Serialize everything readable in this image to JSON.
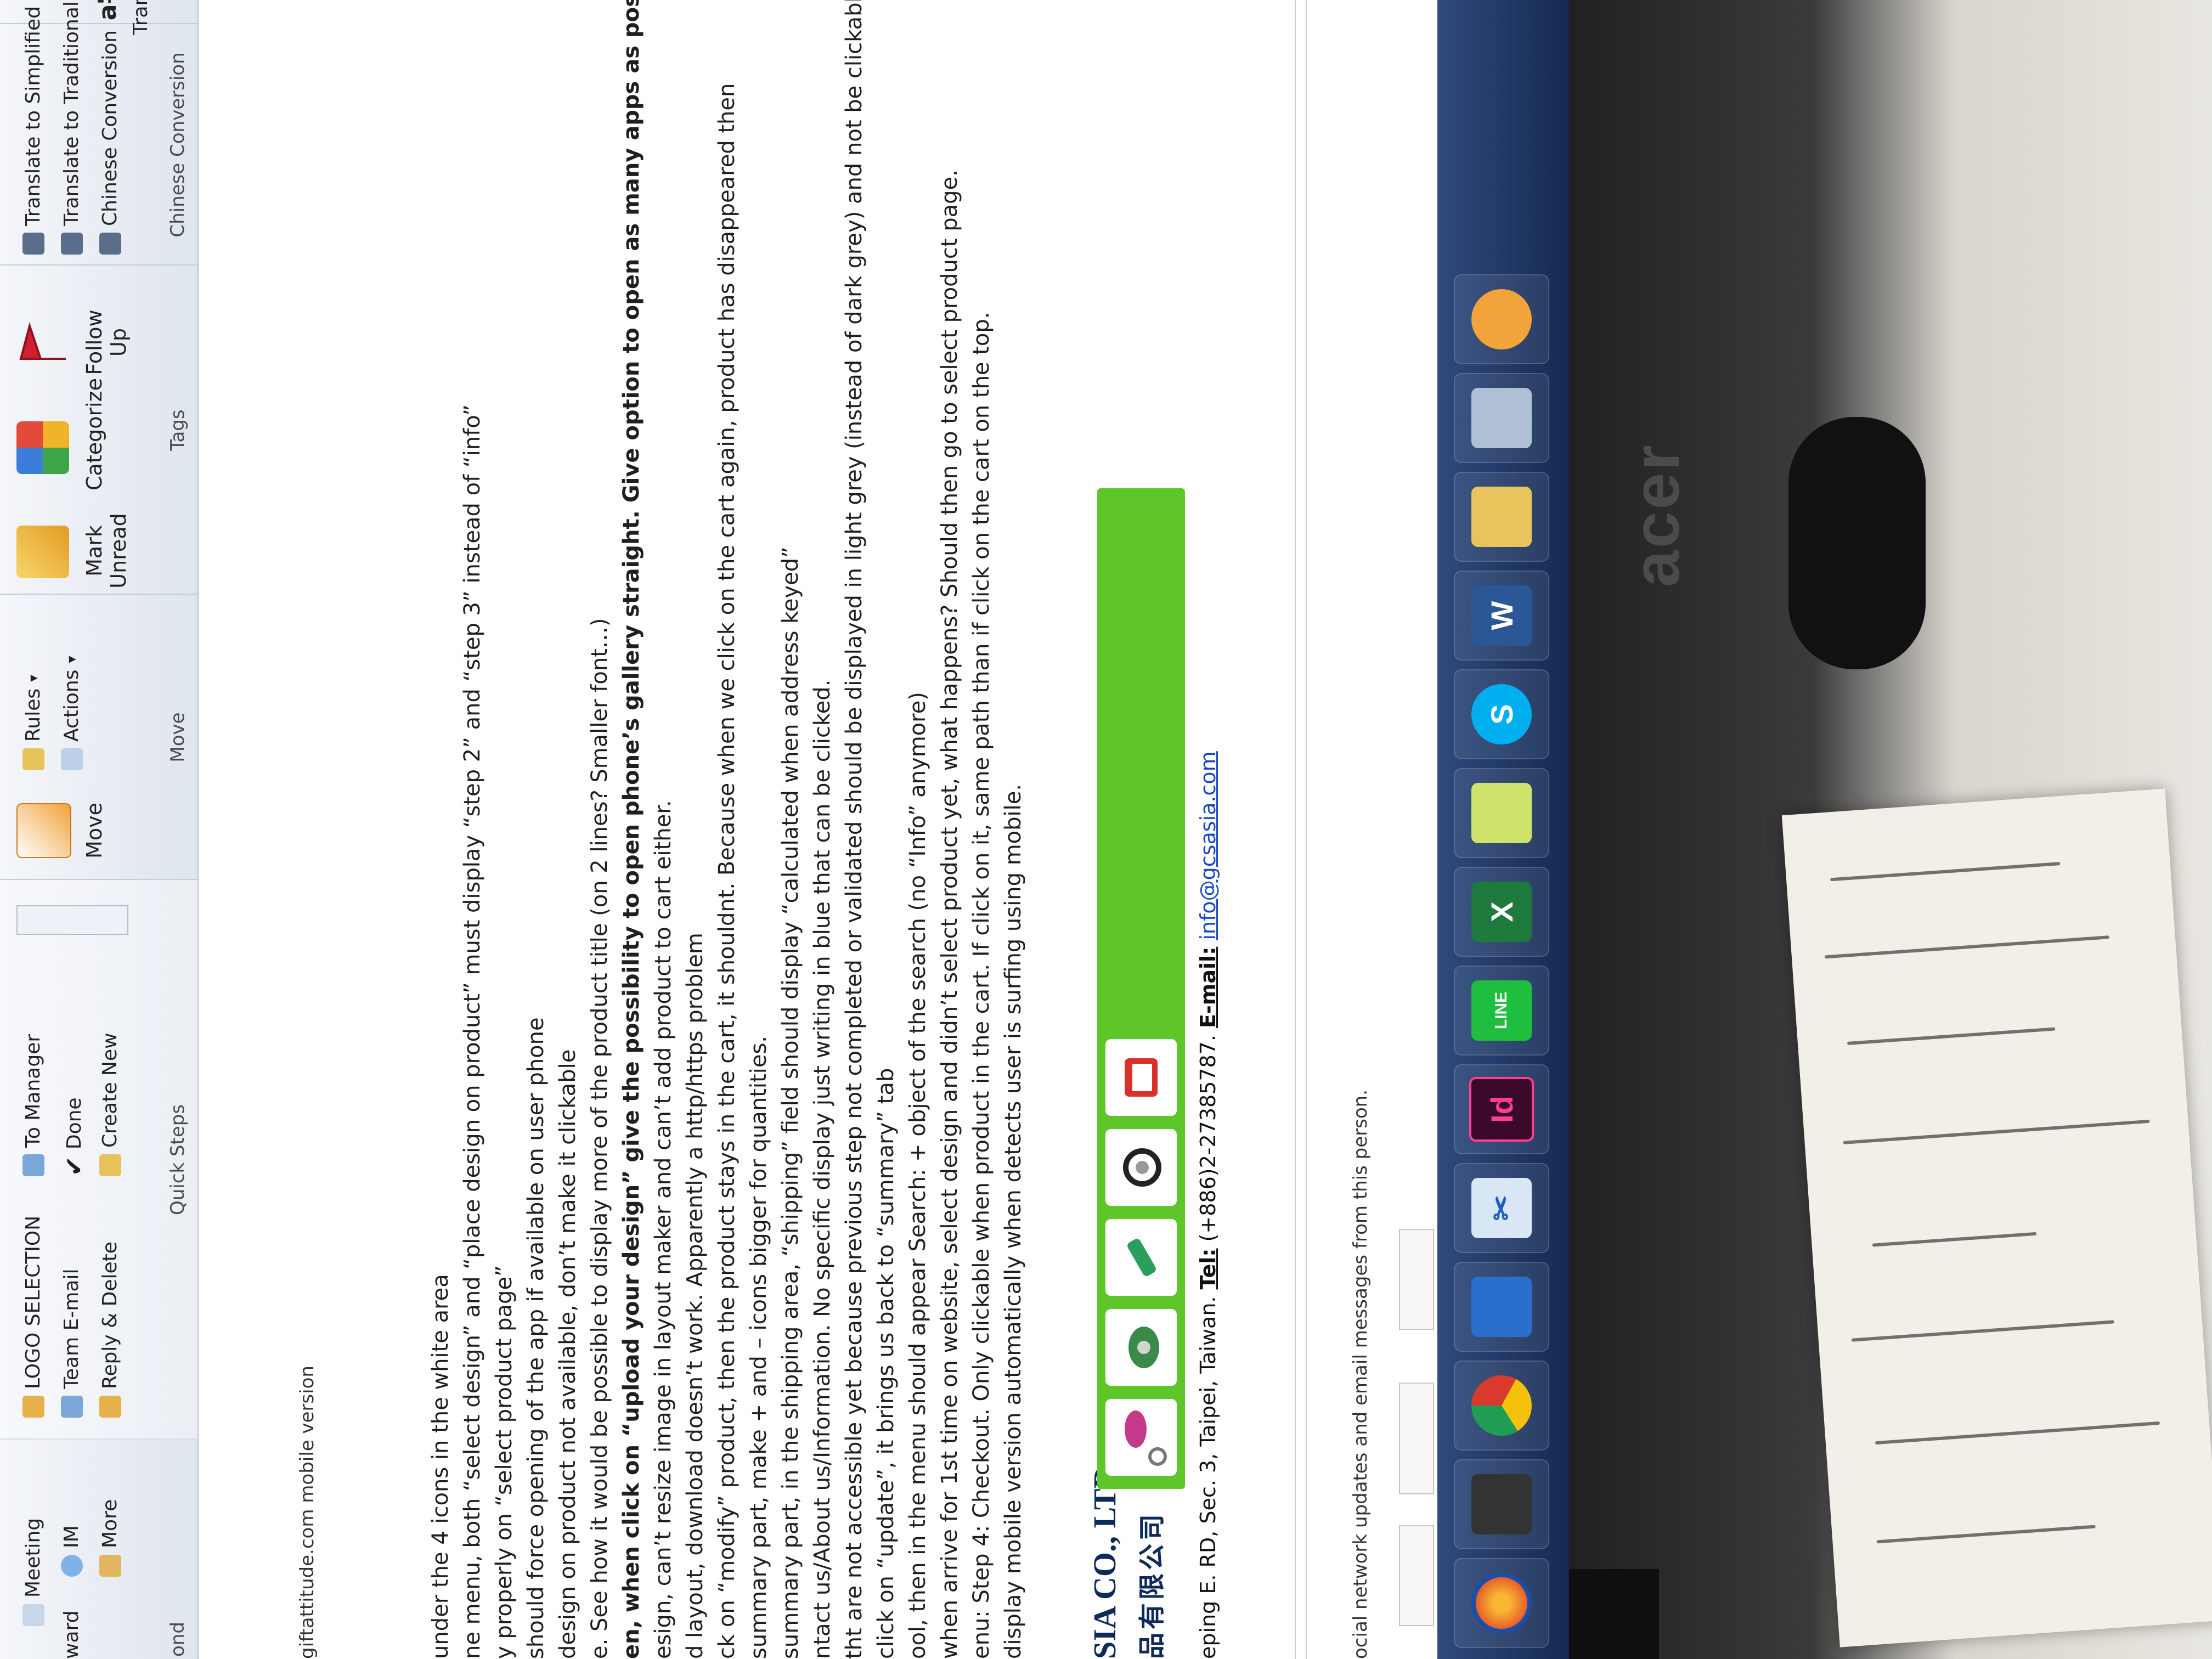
{
  "ribbon": {
    "respond": {
      "forward_label": "ward",
      "meeting_label": "Meeting",
      "im_label": "IM",
      "more_label": "More",
      "group_label": "ond"
    },
    "quick_steps": {
      "items": [
        "LOGO SELECTION",
        "Team E-mail",
        "Reply & Delete",
        "To Manager",
        "Done",
        "Create New"
      ],
      "group_label": "Quick Steps"
    },
    "move": {
      "move_label": "Move",
      "rules_label": "Rules",
      "actions_label": "Actions",
      "group_label": "Move"
    },
    "tags": {
      "mark_unread_label": "Mark Unread",
      "categorize_label": "Categorize",
      "follow_up_label": "Follow Up",
      "group_label": "Tags"
    },
    "chinese": {
      "simplified_label": "Translate to Simplified Chinese",
      "traditional_label": "Translate to Traditional Chinese",
      "conversion_label": "Chinese Conversion",
      "group_label": "Chinese Conversion"
    },
    "translate_label": "Transla"
  },
  "mail": {
    "subject": "giftattitude.com mobile version",
    "lines": [
      "under the 4 icons in the white area",
      "ne menu, both “select design” and “place design on product” must display “step 2” and “step 3” instead of “info”",
      "y properly on “select product page”",
      "should force opening of the app if available on user phone",
      "design on product not available, don’t make it clickable",
      "e. See how it would be possible to display more of the product title (on 2 lines? Smaller font…)",
      "en, when click on “upload your design” give the possibility to open phone’s gallery straight. Give option to open as many apps as possible basically.",
      "esign, can’t resize image in layout maker and can’t add product to cart either.",
      "d layout, download doesn’t work. Apparently a http/https problem",
      "ck on “modify” product, then the product stays in the cart, it shouldnt. Because when we click on the cart again, product has disappeared then",
      "summary part, make + and – icons bigger for quantities.",
      "summary part, in the shipping area, “shipping” field should display “calculated when address keyed”",
      "ntact us/About us/Information. No specific display just writing in blue that can be clicked.",
      "tht are not accessible yet because previous step not completed or validated should be displayed in light grey (instead of dark grey) and not be clickable.",
      "click on “update”, it brings us back to “summary” tab",
      "ool, then in the menu should appear Search: + object of the search (no “Info” anymore)",
      "when arrive for 1st time on website, select design and didn’t select product yet, what happens? Should then go to select product page.",
      "enu: Step 4: Checkout. Only clickable when product in the cart. If click on it, same path than if click on the cart on the top.",
      "display mobile version automatically when detects user is surfing using mobile."
    ]
  },
  "signature": {
    "company": "SIA CO., LTD.",
    "chinese": "品有限公司",
    "address_prefix": "eping E. RD, Sec. 3, Taipei, Taiwan.",
    "tel_label": "Tel:",
    "tel_value": "(+886)2-27385787.",
    "email_label": "E-mail:",
    "email_value": "info@gcsasia.com"
  },
  "people_pane": {
    "text": "ocial network updates and email messages from this person."
  },
  "taskbar": {
    "apps": [
      "firefox-icon",
      "camera-icon",
      "chrome-icon",
      "outlook-icon",
      "snipping-tool-icon",
      "indesign-icon",
      "line-icon",
      "excel-icon",
      "folder-icon",
      "skype-icon",
      "word-icon",
      "explorer-icon",
      "calculator-icon",
      "outlook-quick-icon"
    ],
    "line_label": "LINE",
    "indesign_label": "Id",
    "excel_label": "X",
    "skype_label": "S",
    "word_label": "W"
  },
  "monitor": {
    "brand": "acer"
  },
  "colors": {
    "banner_green": "#5fc62a",
    "company_navy": "#0d2a5a",
    "link_blue": "#1a48c4",
    "taskbar": "#1e3563"
  }
}
